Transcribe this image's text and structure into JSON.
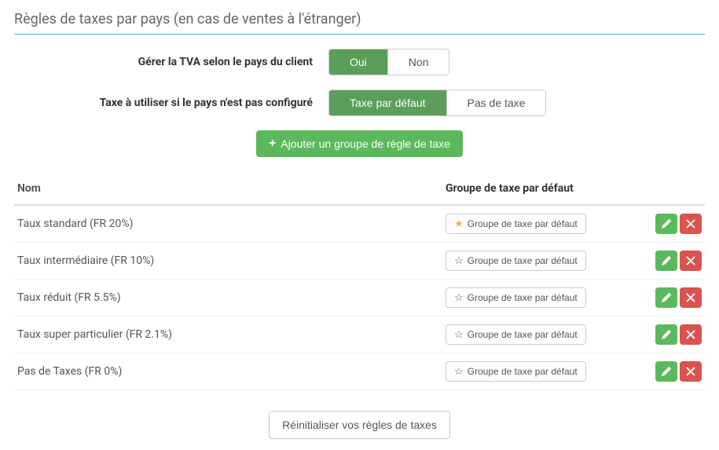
{
  "section": {
    "title": "Règles de taxes par pays (en cas de ventes à l'étranger)"
  },
  "vat_toggle": {
    "label": "Gérer la TVA selon le pays du client",
    "options": {
      "yes": "Oui",
      "no": "Non"
    },
    "selected": "yes"
  },
  "fallback_toggle": {
    "label": "Taxe à utiliser si le pays n'est pas configuré",
    "options": {
      "default": "Taxe par défaut",
      "none": "Pas de taxe"
    },
    "selected": "default"
  },
  "add_button": {
    "label": "Ajouter un groupe de règle de taxe"
  },
  "table": {
    "headers": {
      "name": "Nom",
      "default_group": "Groupe de taxe par défaut"
    },
    "default_btn_label": "Groupe de taxe par défaut",
    "rows": [
      {
        "name": "Taux standard (FR 20%)",
        "is_default": true
      },
      {
        "name": "Taux intermédiaire (FR 10%)",
        "is_default": false
      },
      {
        "name": "Taux réduit (FR 5.5%)",
        "is_default": false
      },
      {
        "name": "Taux super particulier (FR 2.1%)",
        "is_default": false
      },
      {
        "name": "Pas de Taxes (FR 0%)",
        "is_default": false
      }
    ]
  },
  "footer": {
    "reset_label": "Réinitialiser vos règles de taxes"
  }
}
